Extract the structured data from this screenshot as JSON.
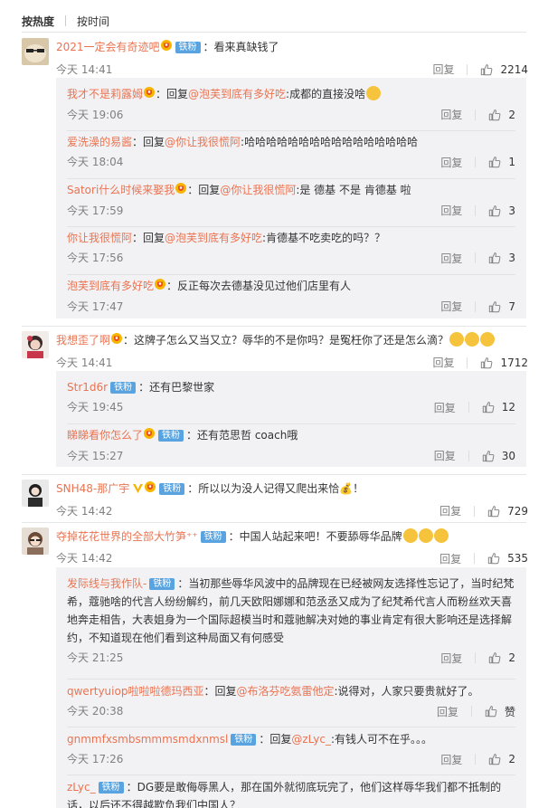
{
  "tabs": {
    "hot": "按热度",
    "time": "按时间"
  },
  "common": {
    "reply": "回复",
    "fan_badge": "铁粉"
  },
  "comments": [
    {
      "name": "2021一定会有奇迹吧",
      "text": "：看来真缺钱了",
      "time": "今天 14:41",
      "likes": "2214",
      "replies": [
        {
          "name": "我才不是莉露姆",
          "prefix": "：回复",
          "at": "@泡芙到底有多好吃",
          "text": ":成都的直接没啥",
          "time": "今天 19:06",
          "likes": "2"
        },
        {
          "name": "爱洗澡的易酱",
          "prefix": "：回复",
          "at": "@你让我很慌阿",
          "text": ":哈哈哈哈哈哈哈哈哈哈哈哈哈哈哈哈",
          "time": "今天 18:04",
          "likes": "1"
        },
        {
          "name": "Satori什么时候来娶我",
          "prefix": "：回复",
          "at": "@你让我很慌阿",
          "text": ":是 德基 不是 肯德基 啦",
          "time": "今天 17:59",
          "likes": "3"
        },
        {
          "name": "你让我很慌阿",
          "prefix": "：回复",
          "at": "@泡芙到底有多好吃",
          "text": ":肯德基不吃卖吃的吗？？",
          "time": "今天 17:56",
          "likes": "3"
        },
        {
          "name": "泡芙到底有多好吃",
          "prefix": "",
          "at": "",
          "text": "：反正每次去德基没见过他们店里有人",
          "time": "今天 17:47",
          "likes": "7"
        }
      ]
    },
    {
      "name": "我想歪了啊",
      "text": "：这牌子怎么又当又立？辱华的不是你吗？是冤枉你了还是怎么滴？",
      "time": "今天 14:41",
      "likes": "1712",
      "replies": [
        {
          "name": "Str1d6r",
          "prefix": "",
          "at": "",
          "text": "：还有巴黎世家",
          "time": "今天 19:45",
          "likes": "12"
        },
        {
          "name": "睇睇看你怎么了",
          "prefix": "",
          "at": "",
          "text": "：还有范思哲 coach哦",
          "time": "今天 15:27",
          "likes": "30"
        }
      ]
    },
    {
      "name": "SNH48-那广宇",
      "text": "：所以以为没人记得又爬出来恰💰！",
      "time": "今天 14:42",
      "likes": "729"
    },
    {
      "name": "夺掉花花世界的全部大竹笋⁺⁺",
      "text": "：中国人站起来吧！不要舔辱华品牌",
      "time": "今天 14:42",
      "likes": "535",
      "replies": [
        {
          "name": "发际线与我作队-",
          "prefix": "",
          "at": "",
          "lines": [
            "：当初那些辱华风波中的品牌现在已经被网友选择性忘记了，当时纪梵",
            "希，蔻驰啥的代言人纷纷解约，前几天欧阳娜娜和范丞丞又成为了纪梵希代言人而粉丝欢天喜",
            "地奔走相告，大表姐身为一个国际超模当时和蔻驰解决对她的事业肯定有很大影响还是选择解",
            "约，不知道现在他们看到这种局面又有何感受"
          ],
          "time": "今天 21:25",
          "likes": "2"
        },
        {
          "name": "qwertyuiop啦啦啦德玛西亚",
          "prefix": "：回复",
          "at": "@布洛芬吃氨雷他定",
          "text": ":说得对，人家只要贵就好了。",
          "time": "今天 20:38",
          "likes": "赞"
        },
        {
          "name": "gnmmfxsmbsmmmsmdxnmsl",
          "prefix": "：回复",
          "at": "@zLyc_",
          "text": ":有钱人可不在乎。。。",
          "time": "今天 17:26",
          "likes": "2"
        },
        {
          "name": "zLyc_",
          "prefix": "",
          "at": "",
          "lines": [
            "：DG要是敢侮辱黑人，那在国外就彻底玩完了，他们这样辱华我们都不抵制的",
            "话，以后还不得越欺负我们中国人？"
          ],
          "time": "",
          "likes": ""
        }
      ]
    }
  ],
  "colors": {
    "accent": "#eb7350",
    "fan_badge": "#59a4e0",
    "subpanel": "#f2f2f5",
    "muted": "#808080"
  },
  "icons": [
    "thumbs-up-icon",
    "gold-badge-icon",
    "verified-v-icon",
    "emoji-icon"
  ]
}
